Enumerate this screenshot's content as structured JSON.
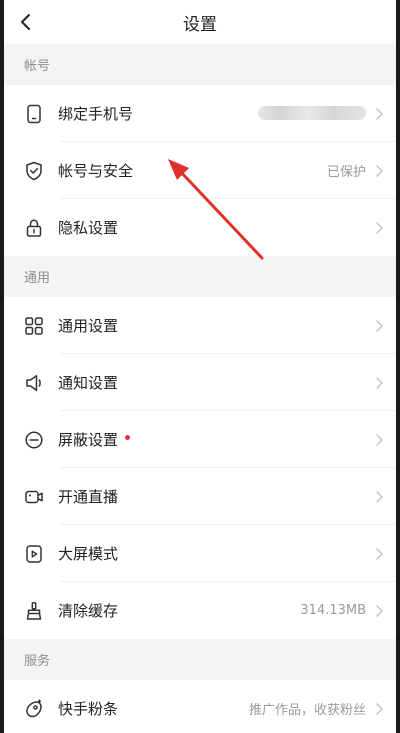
{
  "header": {
    "title": "设置"
  },
  "sections": {
    "account": {
      "title": "帐号",
      "bind_phone": {
        "label": "绑定手机号"
      },
      "security": {
        "label": "帐号与安全",
        "value": "已保护"
      },
      "privacy": {
        "label": "隐私设置"
      }
    },
    "general": {
      "title": "通用",
      "general_settings": {
        "label": "通用设置"
      },
      "notifications": {
        "label": "通知设置"
      },
      "block": {
        "label": "屏蔽设置"
      },
      "live": {
        "label": "开通直播"
      },
      "big_screen": {
        "label": "大屏模式"
      },
      "cache": {
        "label": "清除缓存",
        "value": "314.13MB"
      }
    },
    "services": {
      "title": "服务",
      "fans": {
        "label": "快手粉条",
        "value": "推广作品，收获粉丝"
      }
    }
  },
  "colors": {
    "annotation_arrow": "#e0302b",
    "badge_dot": "#e8313a"
  }
}
